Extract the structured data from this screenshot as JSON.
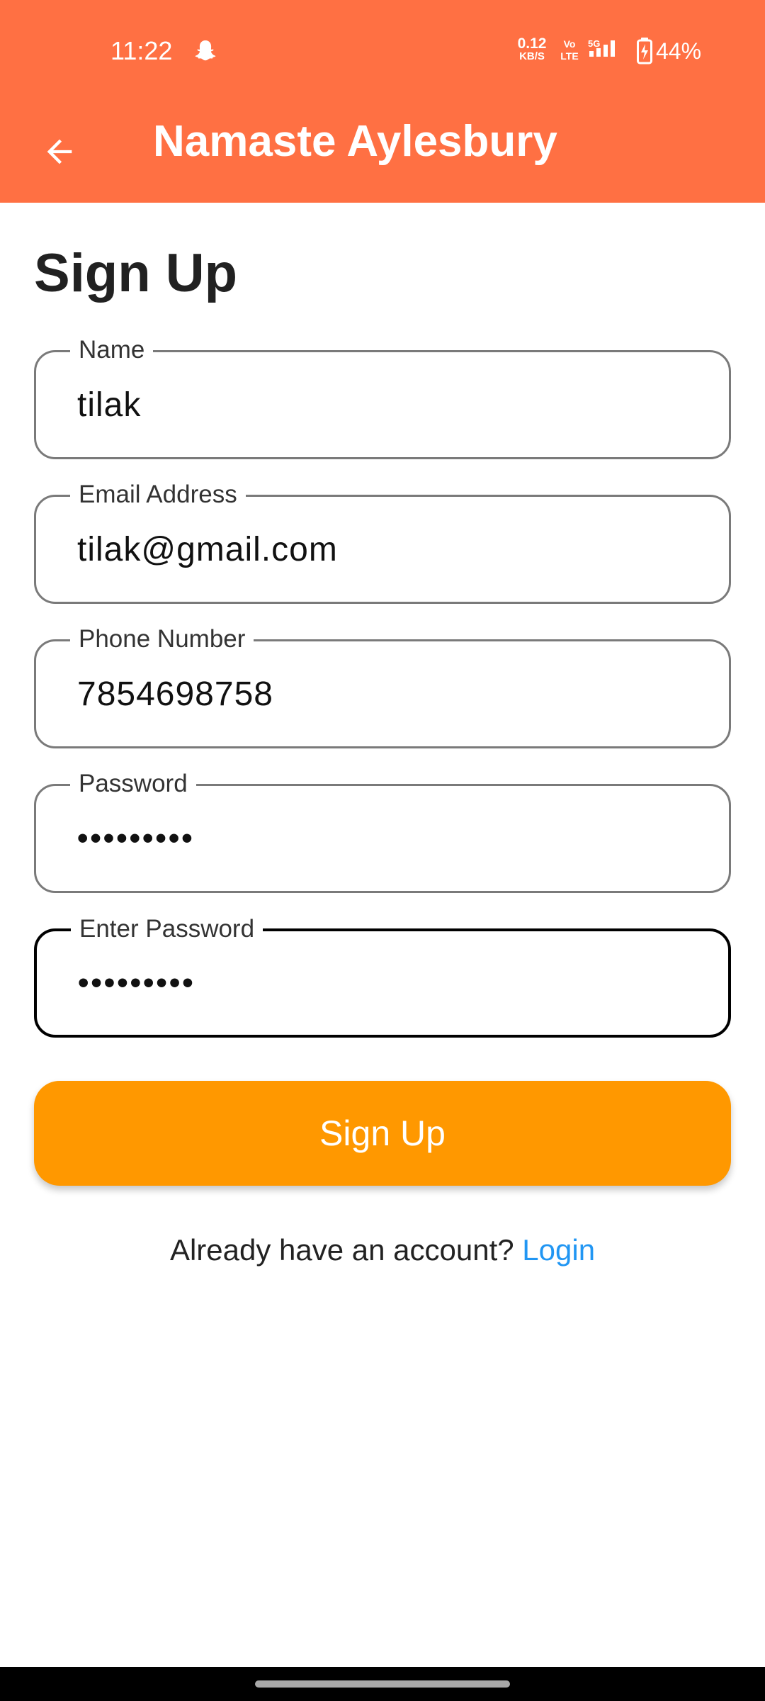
{
  "status_bar": {
    "time": "11:22",
    "net_speed_value": "0.12",
    "net_speed_unit": "KB/S",
    "volte_top": "Vo",
    "volte_bottom": "LTE",
    "network": "5G",
    "battery": "44%",
    "icons": [
      "snapchat-icon",
      "signal-icon",
      "battery-icon"
    ]
  },
  "app_bar": {
    "title": "Namaste Aylesbury",
    "back_icon": "back-arrow-icon",
    "background": "#ff7043"
  },
  "form": {
    "heading": "Sign Up",
    "fields": [
      {
        "label": "Name",
        "value": "tilak"
      },
      {
        "label": "Email Address",
        "value": "tilak@gmail.com"
      },
      {
        "label": "Phone Number",
        "value": "7854698758"
      },
      {
        "label": "Password",
        "value": "•••••••••"
      },
      {
        "label": "Enter Password",
        "value": "•••••••••",
        "focused": true
      }
    ],
    "submit_label": "Sign Up",
    "submit_color": "#ff9800"
  },
  "footer": {
    "prompt": "Already have an account?",
    "link": "Login",
    "link_color": "#2196f3"
  }
}
